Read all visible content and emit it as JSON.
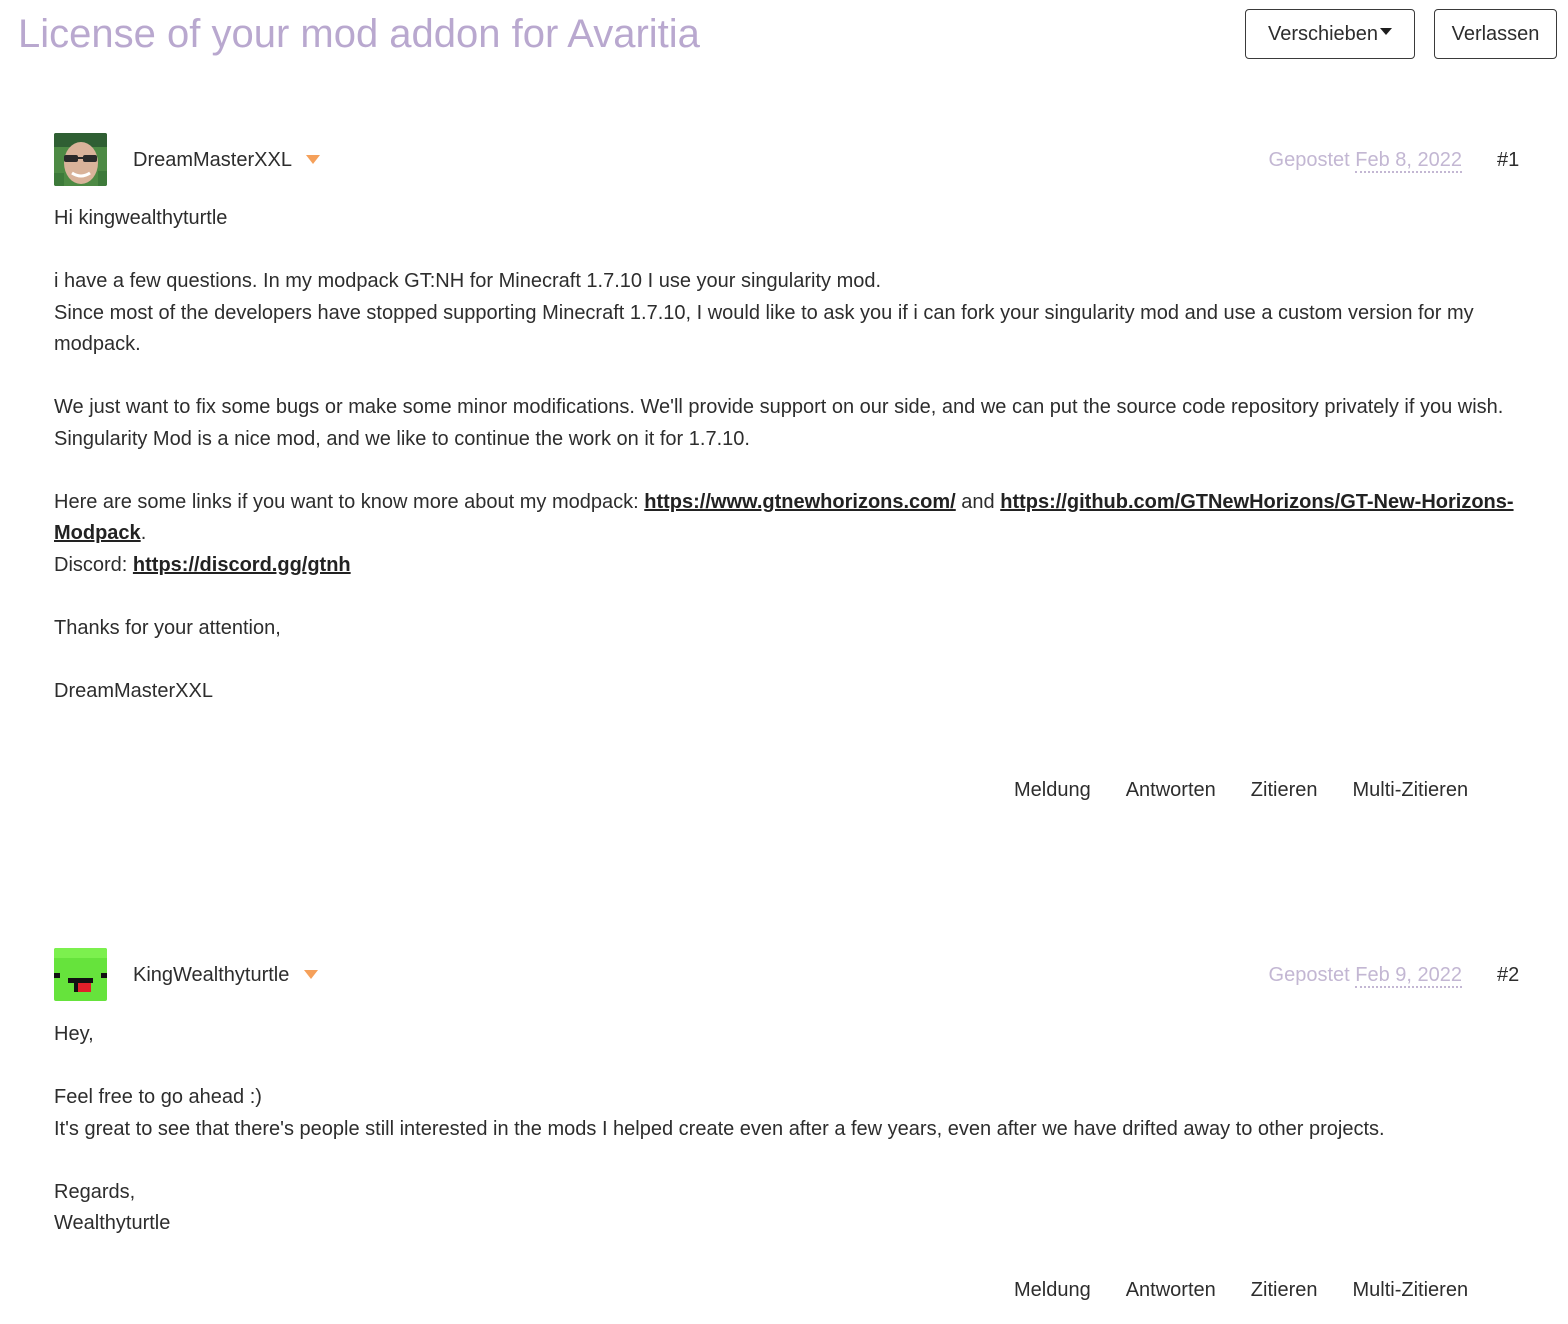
{
  "header": {
    "title": "License of your mod addon for Avaritia",
    "move_button": "Verschieben",
    "leave_button": "Verlassen"
  },
  "posts": [
    {
      "author": "DreamMasterXXL",
      "posted_label": "Gepostet",
      "date": "Feb 8, 2022",
      "number": "#1",
      "lines": {
        "greeting": "Hi kingwealthyturtle",
        "p1": "i have a few questions. In my modpack GT:NH for Minecraft 1.7.10 I use your singularity mod.",
        "p2": "Since most of the developers have stopped supporting Minecraft 1.7.10, I would like to ask you if i can fork your singularity mod and use a custom version for my modpack.",
        "p3": "We just want to fix some bugs or make some minor modifications. We'll provide support on our side, and we can put the source code repository privately if you wish.",
        "p4": "Singularity Mod is a nice mod, and we like to continue the work on it for 1.7.10.",
        "links_intro": "Here are some links if you want to know more about my modpack: ",
        "link1": "https://www.gtnewhorizons.com/",
        "and": " and ",
        "link2": "https://github.com/GTNewHorizons/GT-New-Horizons-Modpack",
        "period": ".",
        "discord_label": "Discord: ",
        "link3": "https://discord.gg/gtnh",
        "thanks": "Thanks for your attention,",
        "signature": "DreamMasterXXL"
      }
    },
    {
      "author": "KingWealthyturtle",
      "posted_label": "Gepostet",
      "date": "Feb 9, 2022",
      "number": "#2",
      "lines": {
        "greeting": "Hey,",
        "p1": "Feel free to go ahead :)",
        "p2": "It's great to see that there's people still interested in the mods I helped create even after a few years, even after we have drifted away to other projects.",
        "regards": "Regards,",
        "signature": "Wealthyturtle"
      }
    }
  ],
  "actions": {
    "report": "Meldung",
    "reply": "Antworten",
    "quote": "Zitieren",
    "multiquote": "Multi-Zitieren"
  },
  "colors": {
    "title": "#b9a8cf",
    "meta": "#c3b7d3",
    "author_caret": "#f5a05a",
    "text": "#2d2d2d"
  },
  "icons": {
    "move_caret": "caret-down-icon",
    "author_menu": "caret-down-icon"
  }
}
